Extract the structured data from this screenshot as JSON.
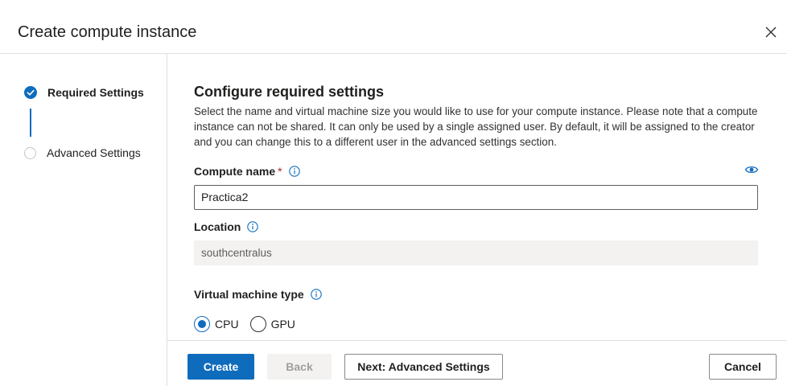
{
  "dialog": {
    "title": "Create compute instance",
    "close_icon": "close-icon"
  },
  "steps": [
    {
      "label": "Required Settings",
      "state": "completed",
      "icon": "check-circle-icon"
    },
    {
      "label": "Advanced Settings",
      "state": "pending",
      "icon": "empty-circle-icon"
    }
  ],
  "main": {
    "heading": "Configure required settings",
    "description": "Select the name and virtual machine size you would like to use for your compute instance. Please note that a compute instance can not be shared. It can only be used by a single assigned user. By default, it will be assigned to the creator and you can change this to a different user in the advanced settings section."
  },
  "fields": {
    "compute_name": {
      "label": "Compute name",
      "required_mark": "*",
      "value": "Practica2"
    },
    "location": {
      "label": "Location",
      "value": "southcentralus"
    },
    "vm_type": {
      "label": "Virtual machine type",
      "options": [
        {
          "label": "CPU",
          "selected": true
        },
        {
          "label": "GPU",
          "selected": false
        }
      ]
    }
  },
  "footer": {
    "create": "Create",
    "back": "Back",
    "next": "Next: Advanced Settings",
    "cancel": "Cancel"
  },
  "colors": {
    "accent": "#0f6cbd",
    "required": "#a4262c"
  }
}
